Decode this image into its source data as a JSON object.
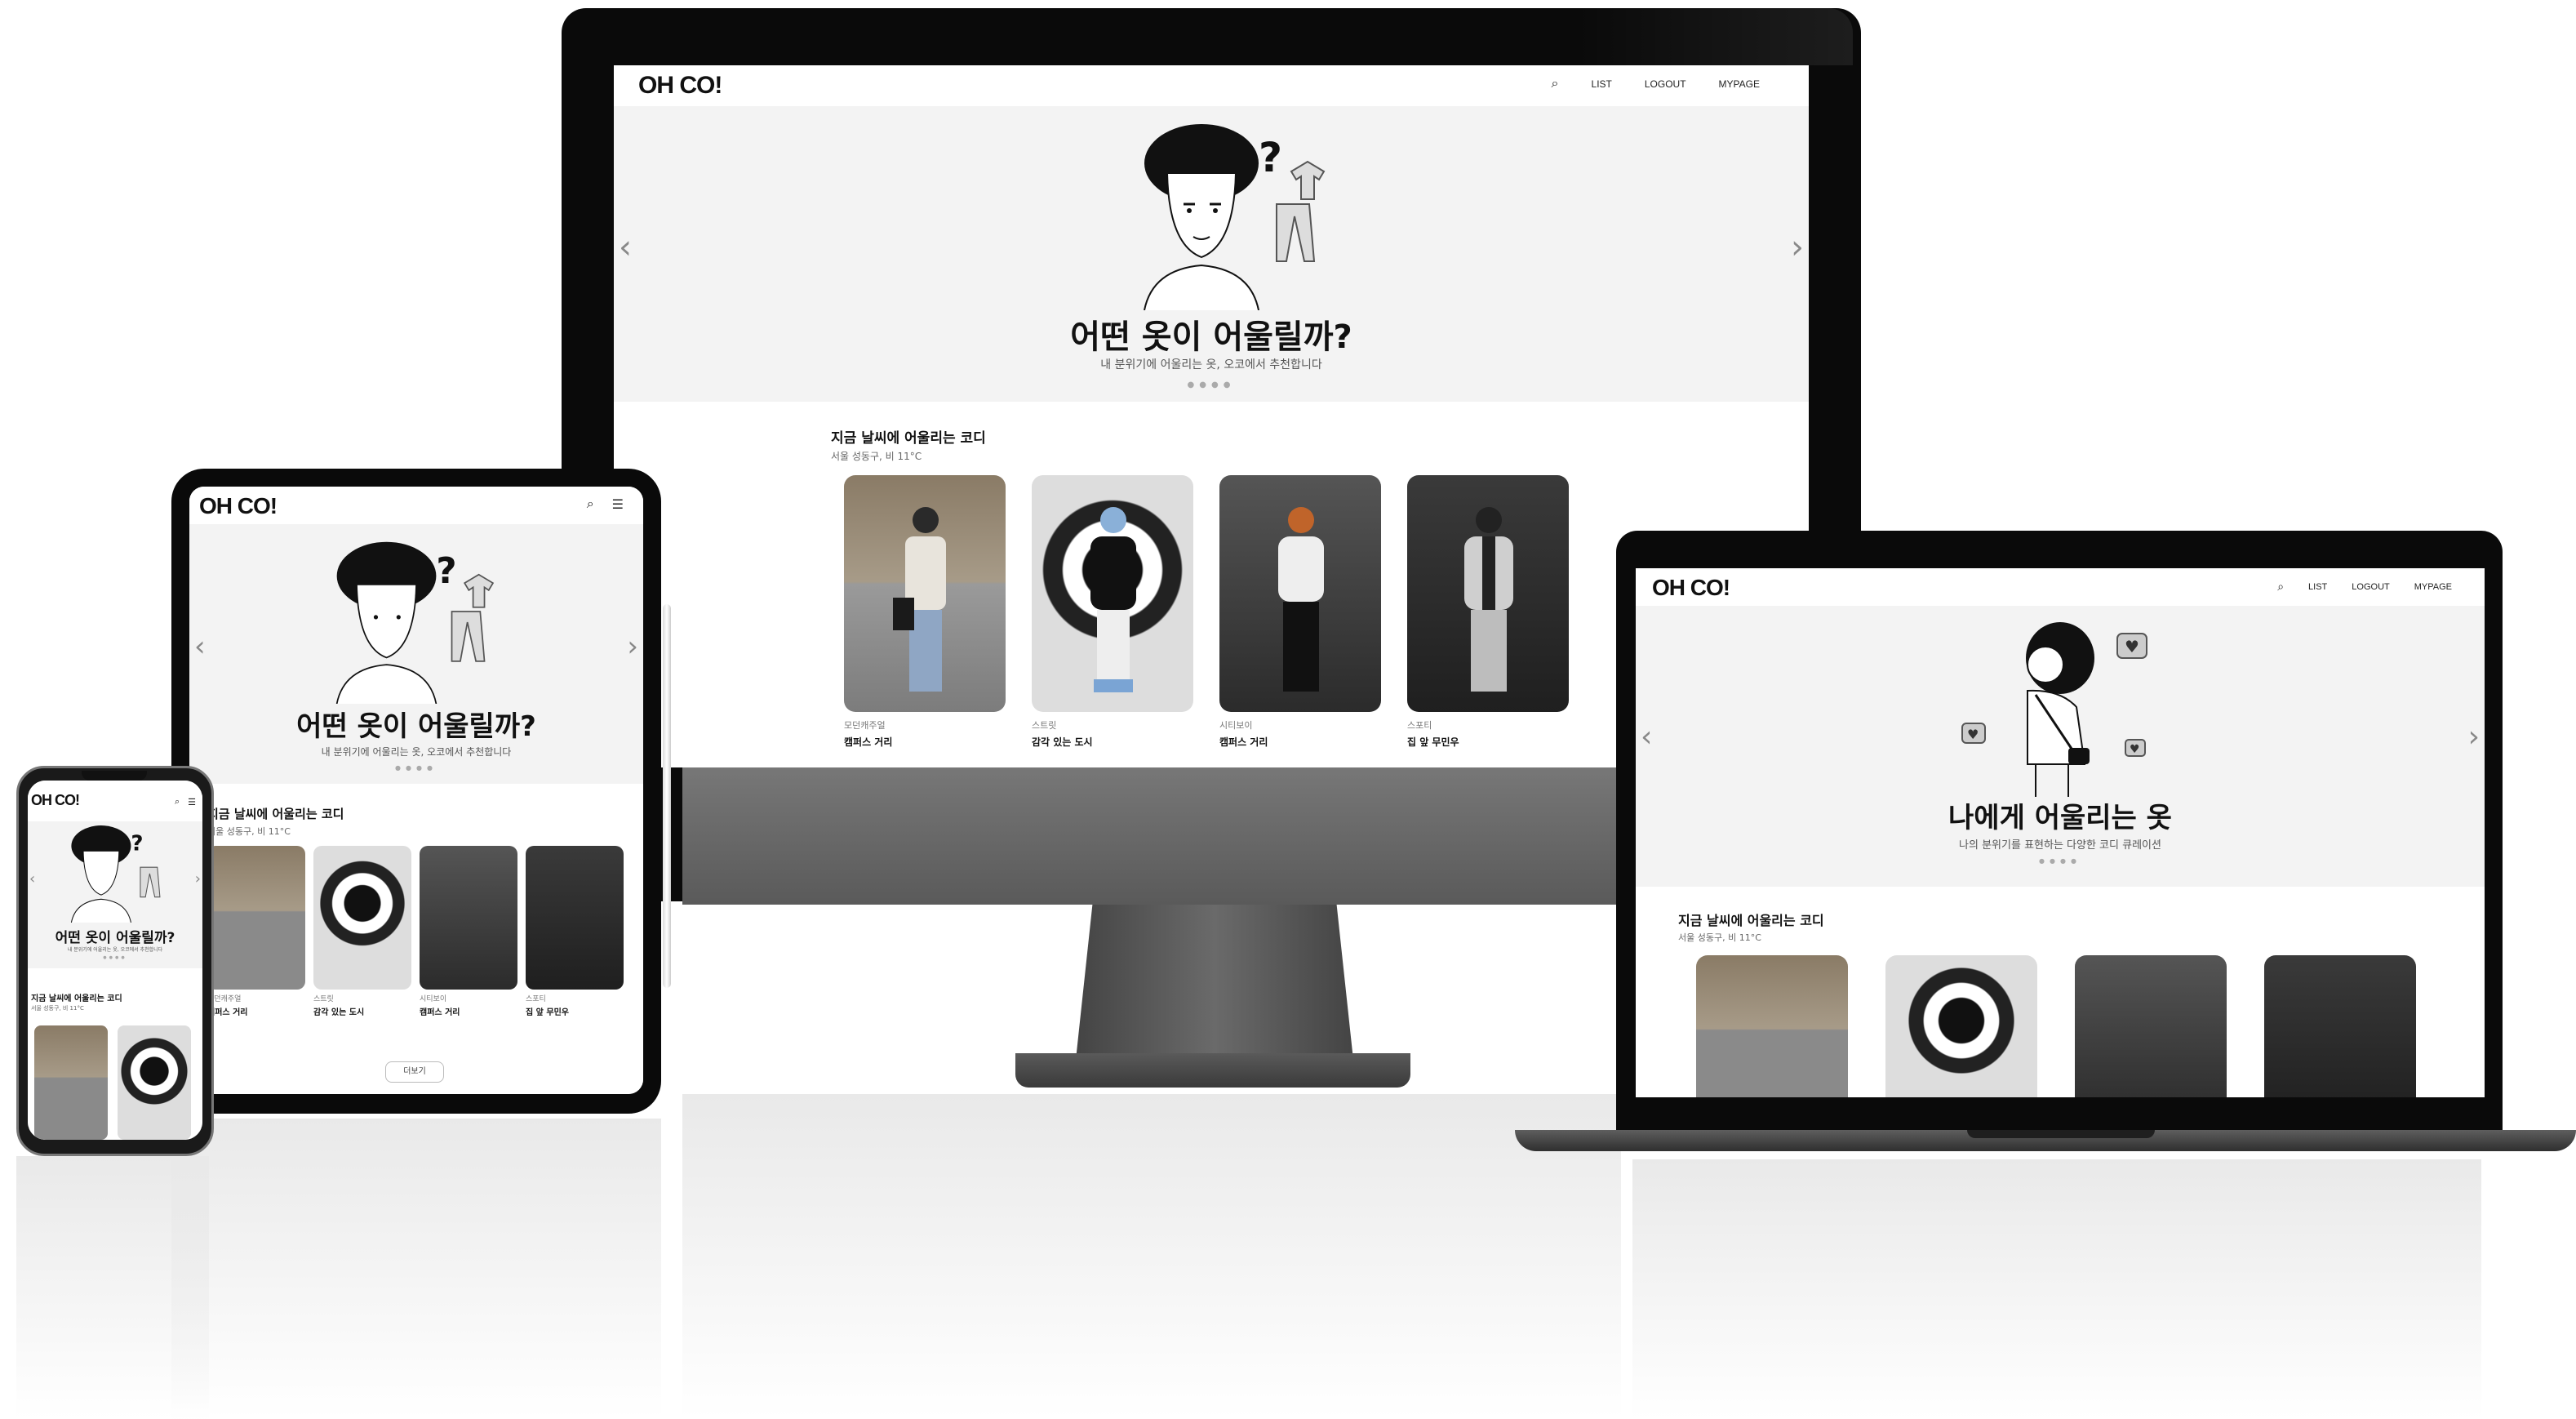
{
  "brand": "OH CO!",
  "nav": {
    "search_icon": "search-icon",
    "list": "LIST",
    "logout": "LOGOUT",
    "mypage": "MYPAGE",
    "menu_icon": "hamburger-icon"
  },
  "hero1": {
    "title": "어떤 옷이 어울릴까?",
    "subtitle": "내 분위기에 어울리는 옷, 오코에서 추천합니다"
  },
  "hero2": {
    "title": "나에게 어울리는 옷",
    "subtitle": "나의 분위기를 표현하는 다양한 코디 큐레이션"
  },
  "section": {
    "title": "지금 날씨에 어울리는 코디",
    "subtitle": "서울 성동구, 비 11°C"
  },
  "cards": [
    {
      "category": "모던캐주얼",
      "name": "캠퍼스 거리"
    },
    {
      "category": "스트릿",
      "name": "감각 있는 도시"
    },
    {
      "category": "시티보이",
      "name": "캠퍼스 거리"
    },
    {
      "category": "스포티",
      "name": "집 앞 무민우"
    }
  ],
  "more_label": "더보기",
  "colors": {
    "bezel": "#0a0a0a",
    "hero_bg": "#f3f3f3",
    "stand": "#555555"
  }
}
